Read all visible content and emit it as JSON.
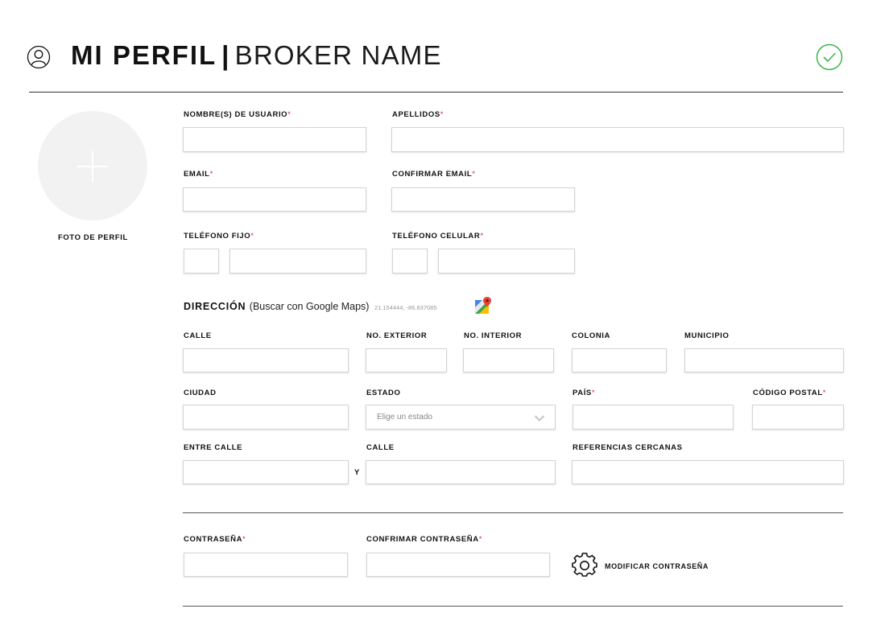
{
  "header": {
    "title_bold": "MI PERFIL",
    "separator": "|",
    "title_light": "BROKER NAME",
    "accent_color": "#3cb64a"
  },
  "profile_photo": {
    "label": "FOTO DE PERFIL",
    "icon": "plus-icon"
  },
  "fields": {
    "nombre": {
      "label": "NOMBRE(S) DE USUARIO",
      "required": "*"
    },
    "apellidos": {
      "label": "APELLIDOS",
      "required": "*"
    },
    "email": {
      "label": "EMAIL",
      "required": "*"
    },
    "confirmar_email": {
      "label": "CONFIRMAR EMAIL",
      "required": "*"
    },
    "telefono_fijo": {
      "label": "TELÉFONO FIJO",
      "required": "*"
    },
    "telefono_celular": {
      "label": "TELÉFONO CELULAR",
      "required": "*"
    }
  },
  "direccion": {
    "title": "DIRECCIÓN",
    "subtitle": "(Buscar con Google Maps)",
    "coords": "21.154444, -86.837085",
    "calle": "CALLE",
    "no_exterior": "NO. EXTERIOR",
    "no_interior": "NO. INTERIOR",
    "colonia": "COLONIA",
    "municipio": "MUNICIPIO",
    "ciudad": "CIUDAD",
    "estado": "ESTADO",
    "estado_placeholder": "Elige un estado",
    "pais": "PAÍS",
    "codigo_postal": "CÓDIGO POSTAL",
    "entre_calle": "ENTRE CALLE",
    "calle2": "CALLE",
    "y": "Y",
    "referencias": "REFERENCIAS CERCANAS",
    "required": "*"
  },
  "password": {
    "contrasena": "CONTRASEÑA",
    "confirmar": "CONFRIMAR CONTRASEÑA",
    "modificar": "MODIFICAR CONTRASEÑA",
    "required": "*"
  }
}
